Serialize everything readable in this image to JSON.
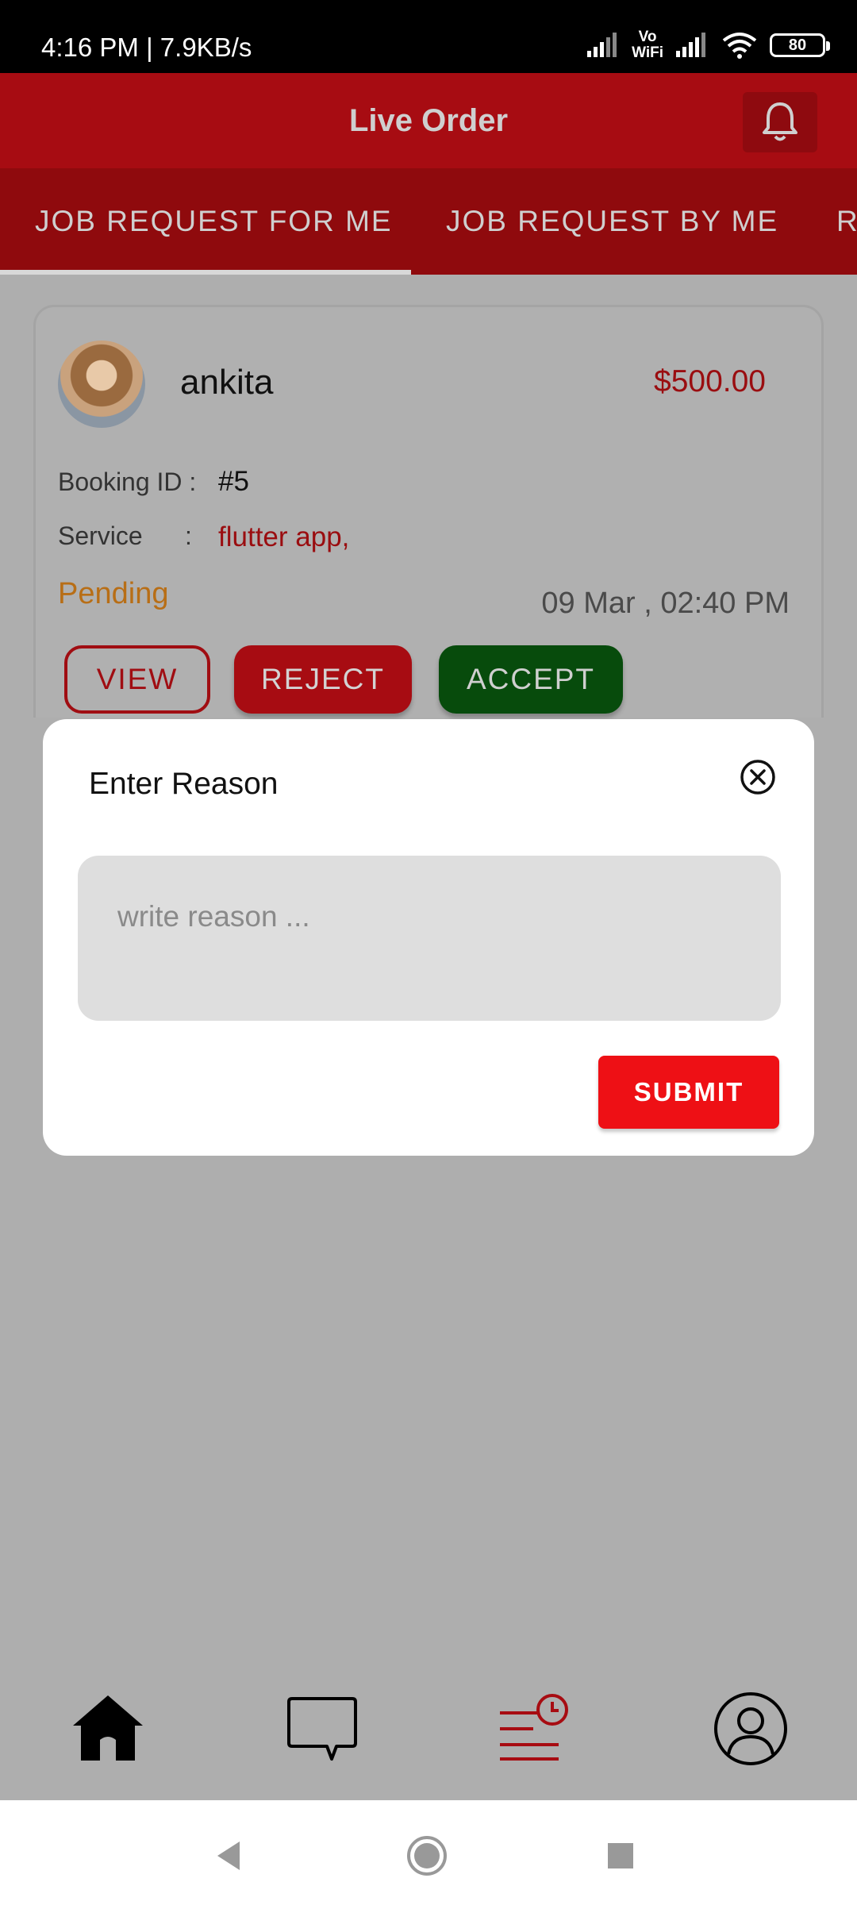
{
  "status_bar": {
    "time": "4:16 PM | 7.9KB/s",
    "vowifi_top": "Vo",
    "vowifi_bottom": "WiFi",
    "battery": "80"
  },
  "header": {
    "title": "Live Order"
  },
  "tabs": [
    {
      "label": "JOB REQUEST FOR ME",
      "active": true
    },
    {
      "label": "JOB REQUEST BY ME",
      "active": false
    },
    {
      "label": "R",
      "active": false
    }
  ],
  "order": {
    "user_name": "ankita",
    "price": "$500.00",
    "booking_label": "Booking ID :",
    "booking_id": "#5",
    "service_label": "Service      :",
    "service": "flutter app,",
    "status": "Pending",
    "datetime": "09 Mar , 02:40 PM",
    "buttons": {
      "view": "VIEW",
      "reject": "REJECT",
      "accept": "ACCEPT"
    }
  },
  "modal": {
    "title": "Enter Reason",
    "placeholder": "write reason ...",
    "submit": "SUBMIT"
  },
  "colors": {
    "brand_red": "#a70c12",
    "accept_green": "#074b0c",
    "submit_red": "#ee1015",
    "pending_orange": "#b86e16"
  },
  "bottom_nav": [
    {
      "icon": "home-icon"
    },
    {
      "icon": "chat-icon"
    },
    {
      "icon": "orders-icon",
      "active": true
    },
    {
      "icon": "profile-icon"
    }
  ]
}
